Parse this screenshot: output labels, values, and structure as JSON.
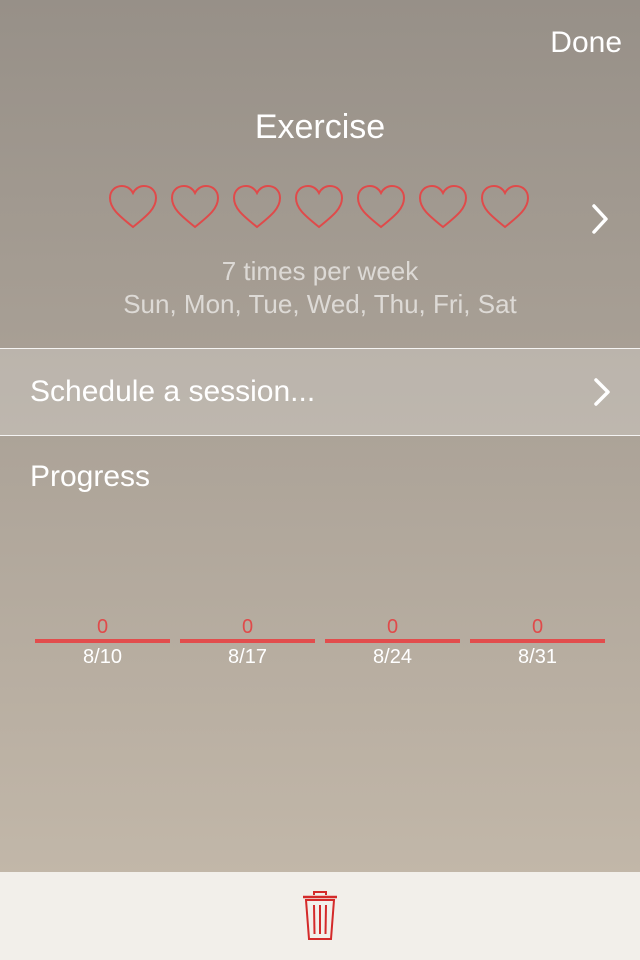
{
  "header": {
    "done_label": "Done"
  },
  "habit": {
    "title": "Exercise",
    "hearts_count": 7,
    "heart_icon": "heart-outline-icon",
    "heart_color": "#e04a4a",
    "frequency": "7 times per week",
    "days": "Sun, Mon, Tue, Wed, Thu, Fri, Sat"
  },
  "schedule": {
    "label": "Schedule a session..."
  },
  "progress": {
    "label": "Progress",
    "weeks": [
      {
        "count": "0",
        "date": "8/10"
      },
      {
        "count": "0",
        "date": "8/17"
      },
      {
        "count": "0",
        "date": "8/24"
      },
      {
        "count": "0",
        "date": "8/31"
      }
    ],
    "bar_color": "#e24d4d"
  },
  "toolbar": {
    "trash_icon": "trash-icon",
    "trash_color": "#d42a2a"
  }
}
